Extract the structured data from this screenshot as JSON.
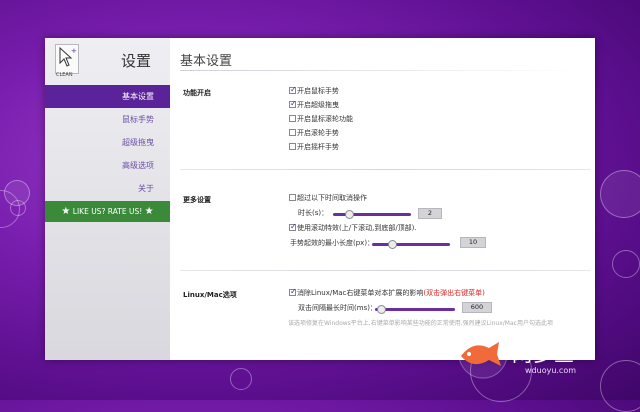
{
  "sidebar": {
    "title": "设置",
    "logo_caption": "CLEAN",
    "items": [
      {
        "label": "基本设置",
        "active": true
      },
      {
        "label": "鼠标手势",
        "active": false
      },
      {
        "label": "超级拖曳",
        "active": false
      },
      {
        "label": "高级选项",
        "active": false
      },
      {
        "label": "关于",
        "active": false
      }
    ],
    "rate": {
      "label": "LIKE US? RATE US!",
      "star": "★"
    }
  },
  "main": {
    "title": "基本设置",
    "sections": {
      "features": {
        "label": "功能开启",
        "options": [
          {
            "label": "开启鼠标手势",
            "checked": true
          },
          {
            "label": "开启超级拖曳",
            "checked": true
          },
          {
            "label": "开启鼠标滚轮功能",
            "checked": false
          },
          {
            "label": "开启滚轮手势",
            "checked": false
          },
          {
            "label": "开启摇杆手势",
            "checked": false
          }
        ]
      },
      "more": {
        "label": "更多设置",
        "timeout_option": {
          "label": "超过以下时间取消操作",
          "checked": false
        },
        "duration": {
          "label": "时长(s)：",
          "value": "2",
          "level": 0.15
        },
        "scroll_option": {
          "label": "使用滚动特效(上/下滚动,到底部/顶部).",
          "checked": true
        },
        "min_length": {
          "label": "手势起效的最小长度(px)：",
          "value": "10",
          "level": 0.2
        }
      },
      "linux_mac": {
        "label": "Linux/Mac选项",
        "option": {
          "label": "消除Linux/Mac右键菜单对本扩展的影响",
          "highlight": "(双击弹出右键菜单)",
          "checked": true
        },
        "interval": {
          "label": "双击间隔最长时间(ms)：",
          "value": "600",
          "level": 0.05
        },
        "note": "该选项修复在Windows平台上,右键菜单影响某些功能的正常使用,强烈建议Linux/Mac用户勾选此项"
      }
    }
  },
  "watermark": {
    "text": "网多鱼",
    "url": "wduoyu.com"
  },
  "colors": {
    "accent": "#5b2399",
    "rate_bg": "#3a8a3a",
    "slider": "#6a2f9f",
    "highlight": "#e02020"
  }
}
